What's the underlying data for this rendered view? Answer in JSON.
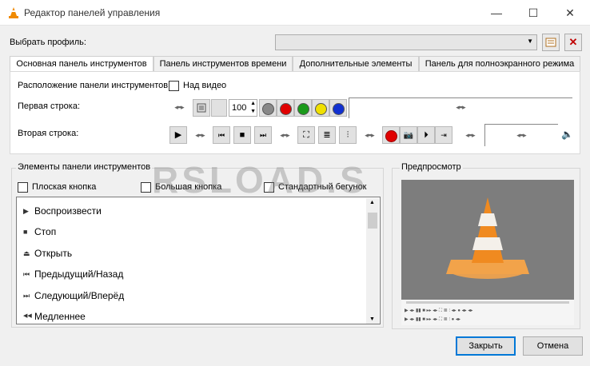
{
  "window": {
    "title": "Редактор панелей управления",
    "minimize": "—",
    "maximize": "☐",
    "close": "✕"
  },
  "profile": {
    "label": "Выбрать профиль:",
    "value": "",
    "new_icon": "new-profile-icon",
    "delete_icon": "delete-profile-icon"
  },
  "tabs": [
    {
      "label": "Основная панель инструментов",
      "active": true
    },
    {
      "label": "Панель инструментов времени",
      "active": false
    },
    {
      "label": "Дополнительные элементы",
      "active": false
    },
    {
      "label": "Панель для полноэкранного режима",
      "active": false
    }
  ],
  "main": {
    "position_label": "Расположение панели инструментов:",
    "above_video_label": "Над видео",
    "above_video_checked": false,
    "row1_label": "Первая строка:",
    "row2_label": "Вторая строка:",
    "volume_value": "100",
    "spacer_glyph": "◂▪▪▸",
    "colors": [
      "#888888",
      "#e00000",
      "#1a9a1a",
      "#f0e000",
      "#1030d0"
    ]
  },
  "elements": {
    "title": "Элементы панели инструментов",
    "flat_button_label": "Плоская кнопка",
    "big_button_label": "Большая кнопка",
    "standard_slider_label": "Стандартный бегунок",
    "items": [
      {
        "label": "Воспроизвести",
        "icon": "▶"
      },
      {
        "label": "Стоп",
        "icon": "■"
      },
      {
        "label": "Открыть",
        "icon": "⏏"
      },
      {
        "label": "Предыдущий/Назад",
        "icon": "⏮"
      },
      {
        "label": "Следующий/Вперёд",
        "icon": "⏭"
      },
      {
        "label": "Медленнее",
        "icon": "◀◀"
      }
    ]
  },
  "preview": {
    "title": "Предпросмотр"
  },
  "footer": {
    "close_label": "Закрыть",
    "cancel_label": "Отмена"
  },
  "watermark": "RSLOAD.S"
}
